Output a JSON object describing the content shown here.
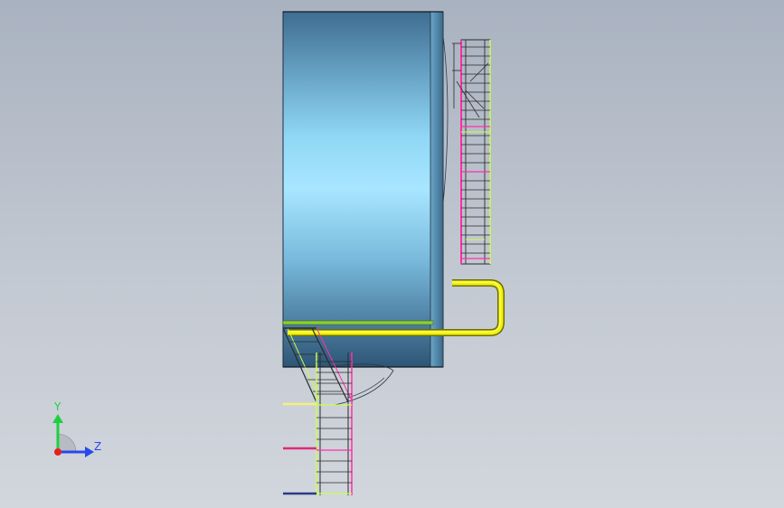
{
  "viewport": {
    "background_top": "#a9b2c0",
    "background_bottom": "#d2d6dd"
  },
  "model": {
    "tank_color_light": "#a8e6ff",
    "tank_color_dark": "#3d6a8c",
    "pipe_color": "#f2f200",
    "ladder_colors": [
      "#ff2fa8",
      "#c8ff4a",
      "#3a3a3a",
      "#ffffff"
    ]
  },
  "triad": {
    "y_label": "Y",
    "z_label": "Z",
    "y_color": "#1fcf3f",
    "z_color": "#2a49e8",
    "x_color": "#e81f1f"
  }
}
